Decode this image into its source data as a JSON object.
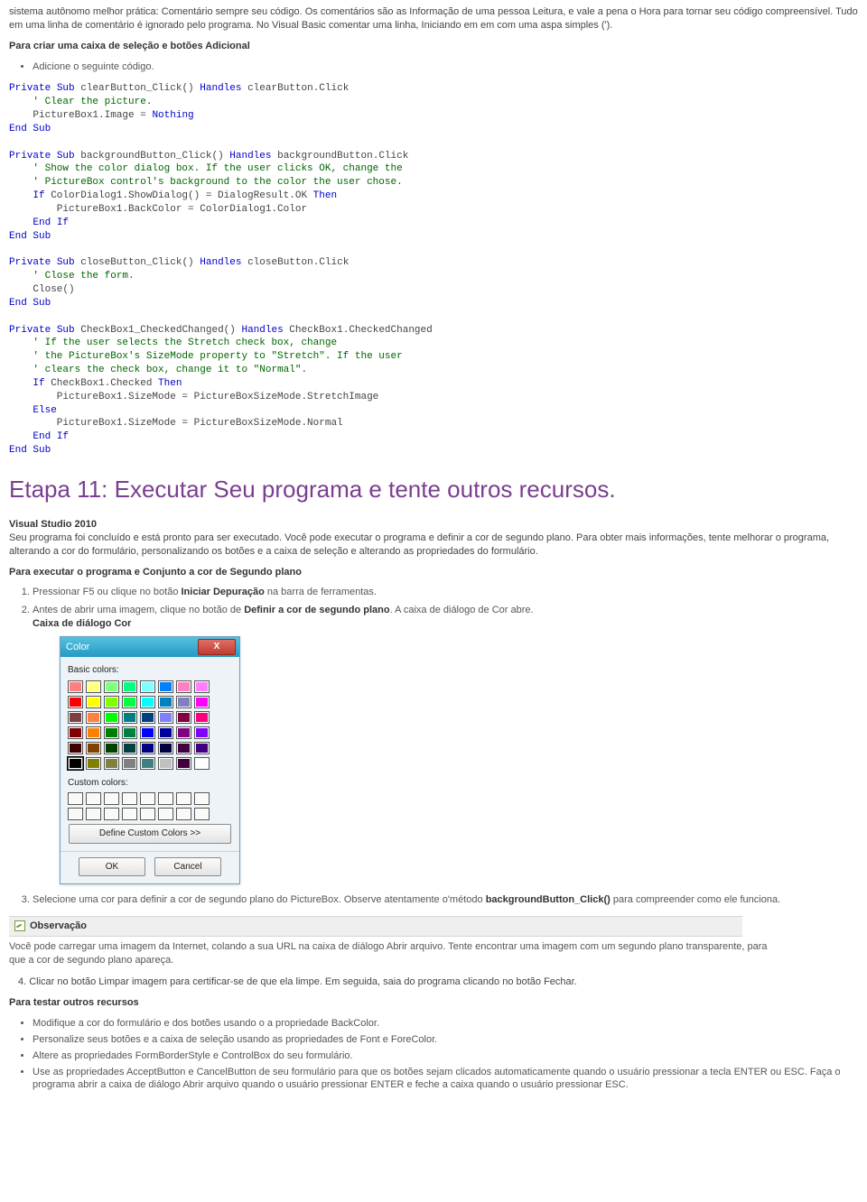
{
  "intro": "sistema autônomo melhor prática: Comentário sempre seu código. Os comentários são as Informação de uma pessoa Leitura, e vale a pena o Hora para tornar seu código compreensível. Tudo em uma linha de comentário é ignorado pelo programa. No Visual Basic comentar uma linha, Iniciando em em com uma aspa simples (').",
  "h_adicional": "Para criar uma caixa de seleção e botões Adicional",
  "li_adicional": "Adicione o seguinte código.",
  "code": {
    "l01a": "Private",
    "l01b": "Sub",
    "l01c": " clearButton_Click() ",
    "l01d": "Handles",
    "l01e": " clearButton.Click",
    "l02": "    ' Clear the picture.",
    "l03a": "    PictureBox1.Image = ",
    "l03b": "Nothing",
    "l04a": "End",
    "l04b": "Sub",
    "l05a": "Private",
    "l05b": "Sub",
    "l05c": " backgroundButton_Click() ",
    "l05d": "Handles",
    "l05e": " backgroundButton.Click",
    "l06": "    ' Show the color dialog box. If the user clicks OK, change the",
    "l07": "    ' PictureBox control's background to the color the user chose.",
    "l08a": "    ",
    "l08b": "If",
    "l08c": " ColorDialog1.ShowDialog() = DialogResult.OK ",
    "l08d": "Then",
    "l09": "        PictureBox1.BackColor = ColorDialog1.Color",
    "l10a": "    ",
    "l10b": "End",
    "l10c": "If",
    "l11a": "End",
    "l11b": "Sub",
    "l12a": "Private",
    "l12b": "Sub",
    "l12c": " closeButton_Click() ",
    "l12d": "Handles",
    "l12e": " closeButton.Click",
    "l13": "    ' Close the form.",
    "l14": "    Close()",
    "l15a": "End",
    "l15b": "Sub",
    "l16a": "Private",
    "l16b": "Sub",
    "l16c": " CheckBox1_CheckedChanged() ",
    "l16d": "Handles",
    "l16e": " CheckBox1.CheckedChanged",
    "l17": "    ' If the user selects the Stretch check box, change",
    "l18": "    ' the PictureBox's SizeMode property to \"Stretch\". If the user",
    "l19": "    ' clears the check box, change it to \"Normal\".",
    "l20a": "    ",
    "l20b": "If",
    "l20c": " CheckBox1.Checked ",
    "l20d": "Then",
    "l21": "        PictureBox1.SizeMode = PictureBoxSizeMode.StretchImage",
    "l22a": "    ",
    "l22b": "Else",
    "l23": "        PictureBox1.SizeMode = PictureBoxSizeMode.Normal",
    "l24a": "    ",
    "l24b": "End",
    "l24c": "If",
    "l25a": "End",
    "l25b": "Sub"
  },
  "h1": "Etapa 11: Executar Seu programa e tente outros recursos.",
  "vs_label": "Visual Studio 2010",
  "vs_text": "Seu programa foi concluído e está pronto para ser executado. Você pode executar o programa e definir a cor de segundo plano. Para obter mais informações, tente melhorar o programa, alterando a cor do formulário, personalizando os botões e a caixa de seleção e alterando as propriedades do formulário.",
  "h_exec": "Para executar o programa e Conjunto a cor de Segundo plano",
  "ol1_1a": "Pressionar F5 ou clique no botão ",
  "ol1_1b": "Iniciar Depuração",
  "ol1_1c": " na barra de ferramentas.",
  "ol1_2a": "Antes de abrir uma imagem, clique no botão de ",
  "ol1_2b": "Definir a cor de segundo plano",
  "ol1_2c": ". A caixa de diálogo de Cor abre.",
  "ol1_2d": "Caixa de diálogo Cor",
  "ol1_3a": "Selecione uma cor para definir a cor de segundo plano do PictureBox. Observe atentamente o'método ",
  "ol1_3b": "backgroundButton_Click()",
  "ol1_3c": " para compreender como ele funciona.",
  "note_title": "Observação",
  "note_body": "Você pode carregar uma imagem da Internet, colando a sua URL na caixa de diálogo Abrir arquivo. Tente encontrar uma imagem com um segundo plano transparente, para que a cor de segundo plano apareça.",
  "ol1_4": "4. Clicar no botão Limpar imagem para certificar-se de que ela limpe. Em seguida, saia do programa clicando no botão Fechar.",
  "h_test": "Para testar outros recursos",
  "test_ul": {
    "a": "Modifique a cor do formulário e dos botões usando o a propriedade BackColor.",
    "b": "Personalize seus botões e a caixa de seleção usando as propriedades de Font e ForeColor.",
    "c": "Altere as propriedades FormBorderStyle e ControlBox do seu formulário.",
    "d": "Use as propriedades AcceptButton e CancelButton de seu formulário para que os botões sejam clicados automaticamente quando o usuário pressionar a tecla ENTER ou ESC. Faça o programa abrir a caixa de diálogo Abrir arquivo quando o usuário pressionar ENTER e feche a caixa quando o usuário pressionar ESC."
  },
  "dialog": {
    "title": "Color",
    "basic_label": "Basic colors:",
    "custom_label": "Custom colors:",
    "define_btn": "Define Custom Colors >>",
    "ok": "OK",
    "cancel": "Cancel",
    "close_x": "X",
    "basic_colors": [
      "#ff8080",
      "#ffff80",
      "#80ff80",
      "#00ff80",
      "#80ffff",
      "#0080ff",
      "#ff80c0",
      "#ff80ff",
      "#ff0000",
      "#ffff00",
      "#80ff00",
      "#00ff40",
      "#00ffff",
      "#0080c0",
      "#8080c0",
      "#ff00ff",
      "#804040",
      "#ff8040",
      "#00ff00",
      "#008080",
      "#004080",
      "#8080ff",
      "#800040",
      "#ff0080",
      "#800000",
      "#ff8000",
      "#008000",
      "#008040",
      "#0000ff",
      "#0000a0",
      "#800080",
      "#8000ff",
      "#400000",
      "#804000",
      "#004000",
      "#004040",
      "#000080",
      "#000040",
      "#400040",
      "#400080",
      "#000000",
      "#808000",
      "#808040",
      "#808080",
      "#408080",
      "#c0c0c0",
      "#400040",
      "#ffffff"
    ]
  }
}
